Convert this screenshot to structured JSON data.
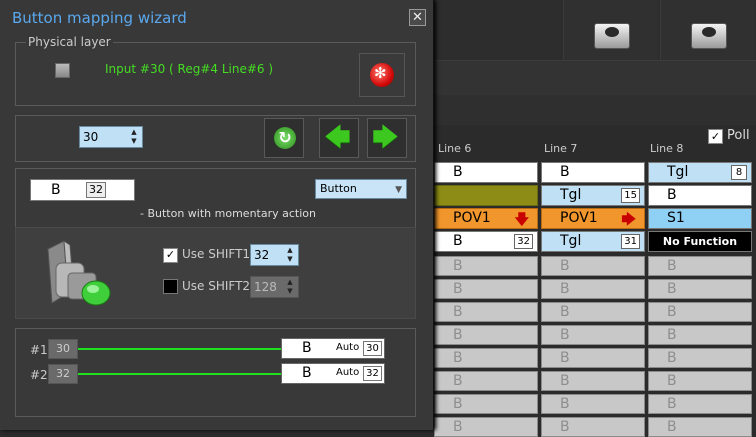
{
  "dialog": {
    "title": "Button mapping wizard",
    "close_symbol": "✕",
    "physical_layer": {
      "legend": "Physical layer",
      "input_text": "Input #30  ( Reg#4   Line#6 )"
    },
    "input_spin": {
      "value": "30"
    },
    "mapping": {
      "button_value": "B",
      "button_index": "32",
      "type_selected": "Button",
      "description": "- Button with momentary action"
    },
    "shift1": {
      "label": "Use SHIFT1",
      "checked_symbol": "✓",
      "value": "32"
    },
    "shift2": {
      "label": "Use SHIFT2",
      "value": "128"
    },
    "outputs": [
      {
        "num": "#1",
        "in": "30",
        "value": "B",
        "mode": "Auto",
        "index": "30"
      },
      {
        "num": "#2",
        "in": "32",
        "value": "B",
        "mode": "Auto",
        "index": "32"
      }
    ]
  },
  "background": {
    "poll_label": "Poll",
    "poll_checked_symbol": "✓",
    "columns": [
      "Line 6",
      "Line 7",
      "Line 8"
    ],
    "rows": [
      [
        {
          "text": "B"
        },
        {
          "text": "B"
        },
        {
          "text": "Tgl",
          "badge": "8"
        }
      ],
      [
        {
          "text": ""
        },
        {
          "text": "Tgl",
          "badge": "15"
        },
        {
          "text": "B"
        }
      ],
      [
        {
          "text": "POV1",
          "arrow": "🡇"
        },
        {
          "text": "POV1",
          "arrow": "🡆"
        },
        {
          "text": "S1"
        }
      ],
      [
        {
          "text": "B",
          "badge": "32"
        },
        {
          "text": "Tgl",
          "badge": "31"
        },
        {
          "text": "No Function"
        }
      ]
    ],
    "empty_cell_text": "B"
  },
  "colors": {
    "accent_title": "#5aa8ee",
    "input_green": "#44dd22",
    "line_green": "#1ee01e",
    "pov_orange": "#f0962c",
    "cell_blue": "#bfe0f5"
  }
}
